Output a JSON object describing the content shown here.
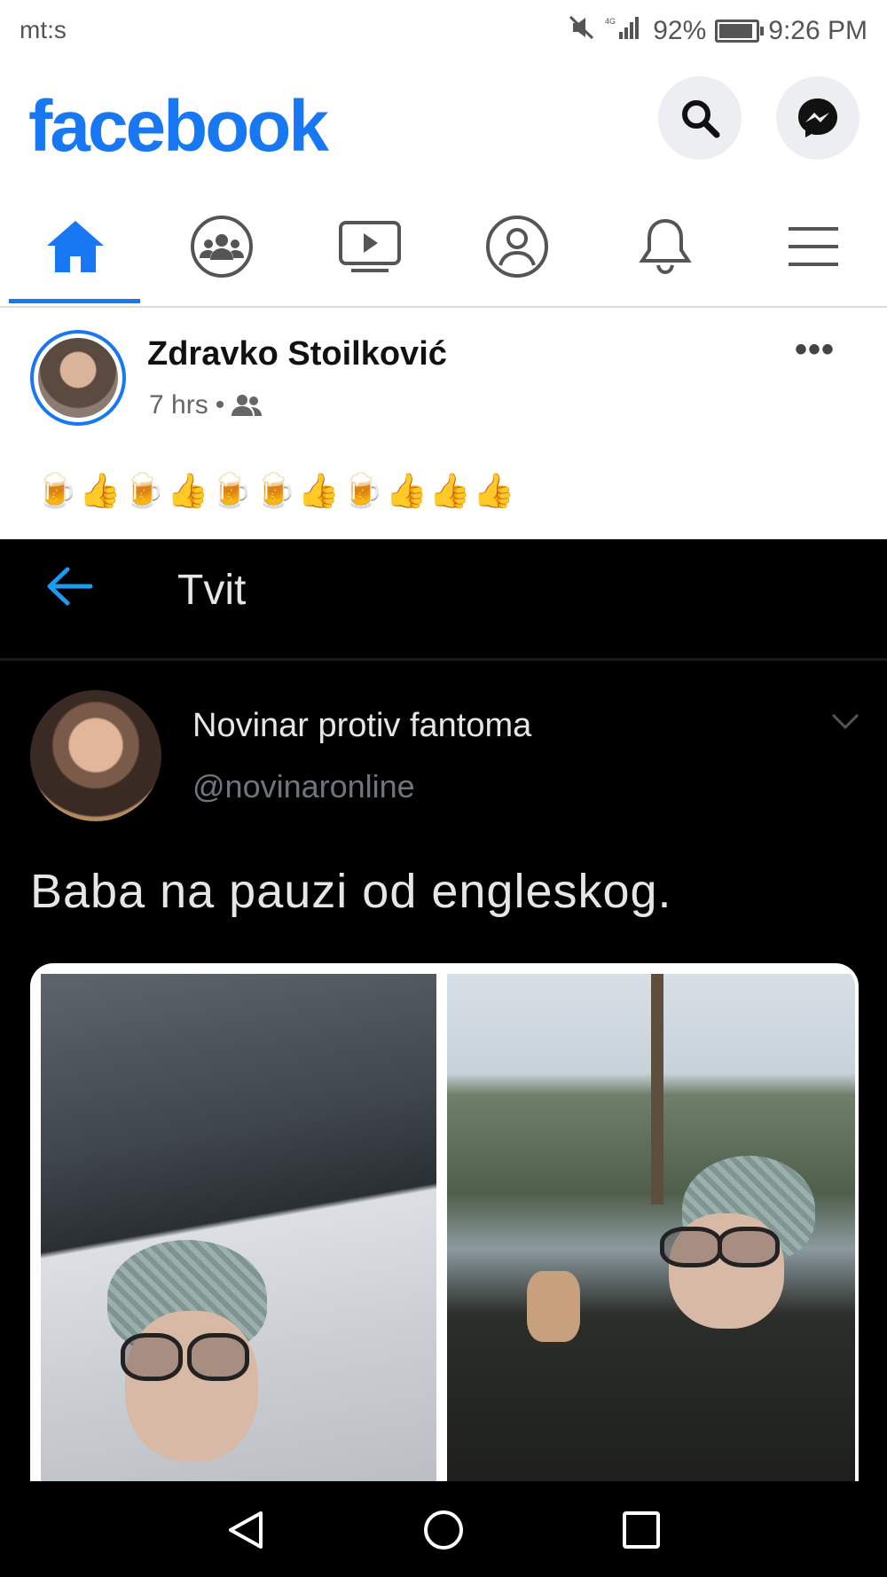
{
  "status_bar": {
    "carrier": "mt:s",
    "battery_percent": "92%",
    "battery_level": 0.92,
    "time": "9:26 PM",
    "network": "4G"
  },
  "header": {
    "logo": "facebook",
    "search_icon": "search-icon",
    "messenger_icon": "messenger-icon"
  },
  "nav": {
    "tabs": [
      {
        "icon": "home-icon",
        "active": true
      },
      {
        "icon": "groups-icon",
        "active": false
      },
      {
        "icon": "watch-icon",
        "active": false
      },
      {
        "icon": "profile-icon",
        "active": false
      },
      {
        "icon": "bell-icon",
        "active": false
      },
      {
        "icon": "menu-icon",
        "active": false
      }
    ],
    "accent_color": "#1877f2"
  },
  "post": {
    "author": "Zdravko Stoilković",
    "time": "7 hrs",
    "separator": "•",
    "audience_icon": "friends-icon",
    "more": "•••",
    "text": "🍺👍🍺👍🍺🍺👍🍺👍👍👍"
  },
  "tweet": {
    "header_title": "Tvit",
    "name": "Novinar protiv fantoma",
    "handle": "@novinaronline",
    "text": "Baba na pauzi od engleskog."
  }
}
